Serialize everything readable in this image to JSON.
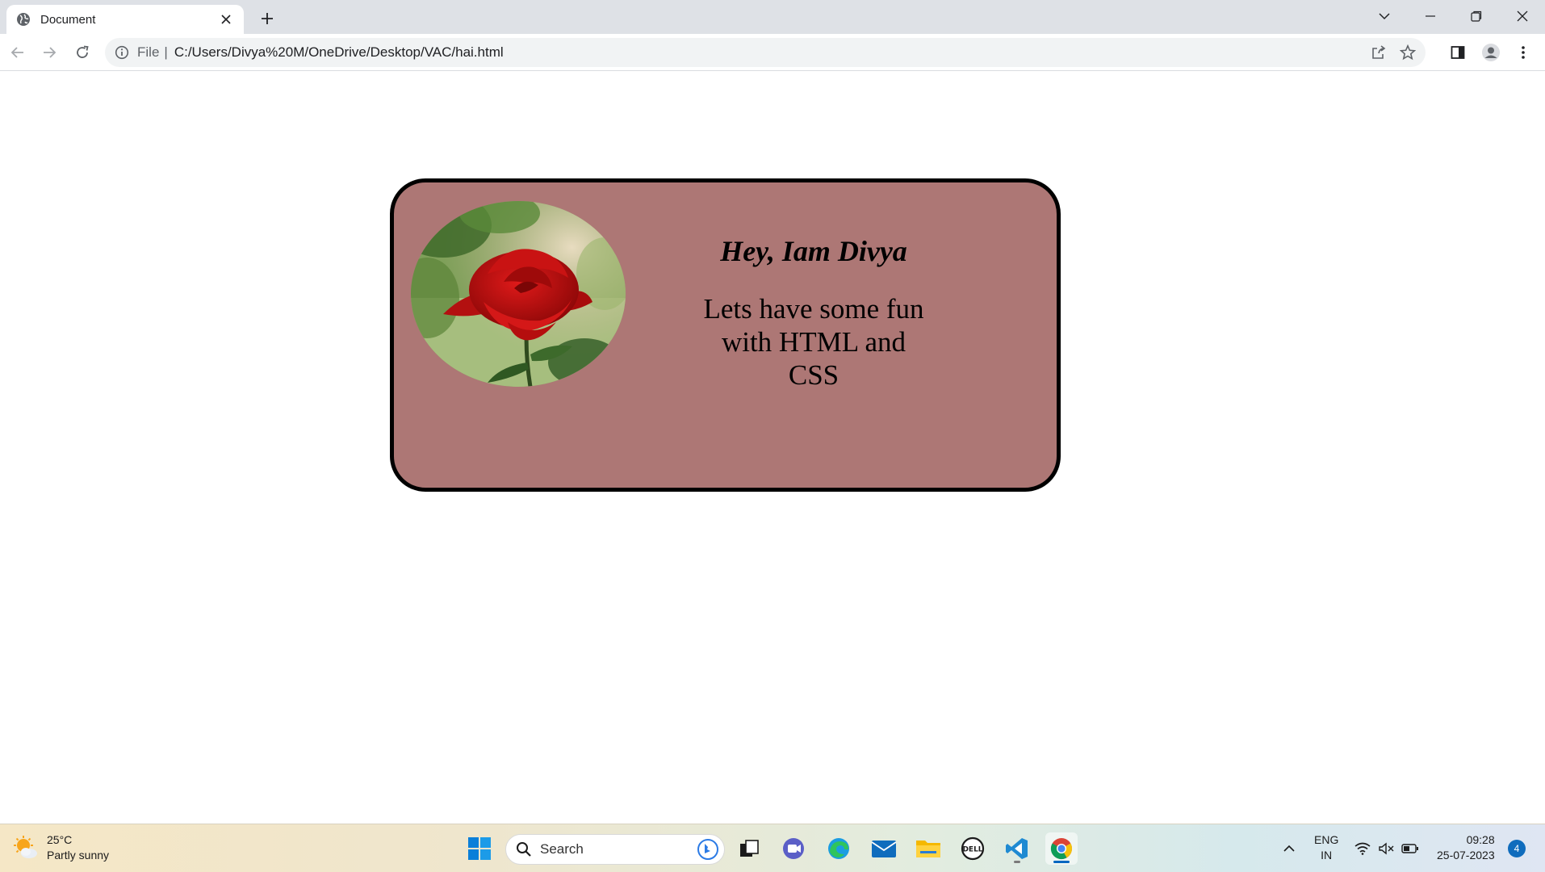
{
  "browser": {
    "tab_title": "Document",
    "url_scheme": "File",
    "url_separator": "|",
    "url": "C:/Users/Divya%20M/OneDrive/Desktop/VAC/hai.html"
  },
  "card": {
    "title": "Hey, Iam Divya",
    "body": "Lets have some fun with HTML and CSS",
    "background_color": "#ad7775",
    "image": "red-rose-photo"
  },
  "taskbar": {
    "weather_temp": "25°C",
    "weather_desc": "Partly sunny",
    "search_placeholder": "Search",
    "lang_line1": "ENG",
    "lang_line2": "IN",
    "time": "09:28",
    "date": "25-07-2023",
    "notification_count": "4",
    "pinned_apps": [
      "start",
      "search",
      "bing-chat",
      "task-view",
      "teams",
      "edge",
      "mail",
      "file-explorer",
      "dell",
      "vscode",
      "chrome"
    ]
  }
}
